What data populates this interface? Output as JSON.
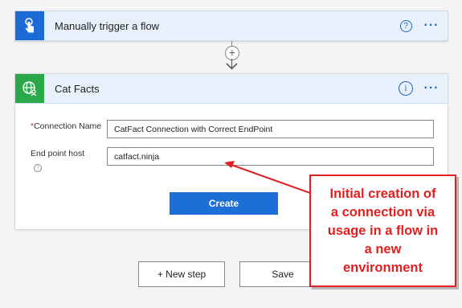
{
  "trigger_card": {
    "title": "Manually trigger a flow",
    "help_icon": "question-circle-icon",
    "more_icon": "ellipsis-icon",
    "icon": "touch-hand-icon",
    "icon_bg": "#1b6ad6"
  },
  "add_step_icon": "plus-icon",
  "catfacts_card": {
    "title": "Cat Facts",
    "icon": "globe-person-icon",
    "icon_bg": "#2aa84a",
    "info_icon": "info-icon",
    "more_icon": "ellipsis-icon",
    "connection_name_label": "Connection Name",
    "connection_name_value": "CatFact Connection with Correct EndPoint",
    "endpoint_host_label": "End point host",
    "endpoint_host_value": "catfact.ninja",
    "create_label": "Create"
  },
  "bottom": {
    "new_step_label": "+ New step",
    "save_label": "Save"
  },
  "callout": {
    "text_lines": [
      "Initial creation of",
      "a connection via",
      "usage in a flow in",
      "a new",
      "environment"
    ],
    "color": "#e02020"
  },
  "colors": {
    "accent": "#2566b5",
    "header_bg": "#e8f1fb",
    "button_blue": "#1d6ed6"
  }
}
